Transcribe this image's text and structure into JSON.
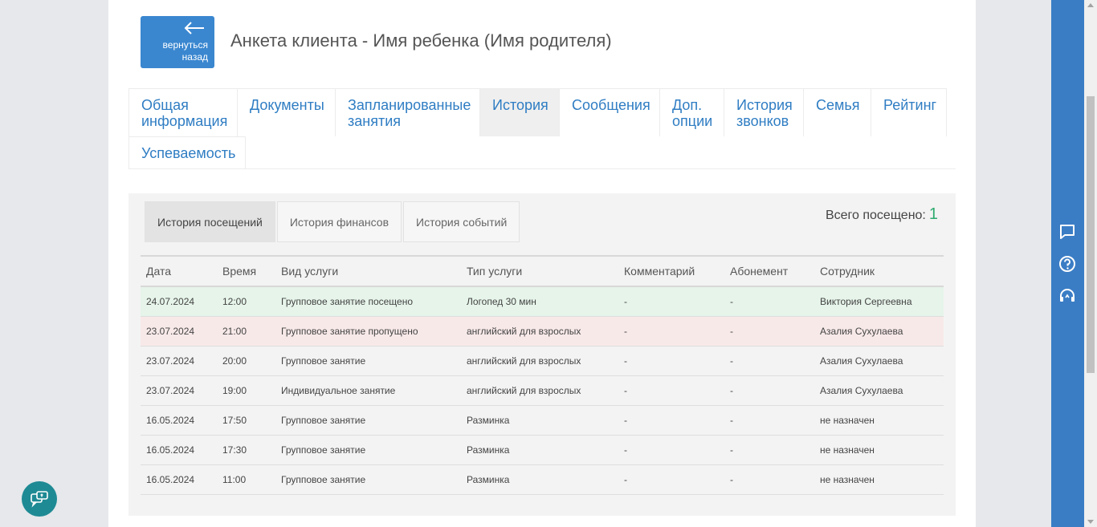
{
  "header": {
    "back_line1": "вернуться",
    "back_line2": "назад",
    "title": "Анкета клиента - Имя ребенка (Имя родителя)"
  },
  "tabs": [
    {
      "l1": "Общая",
      "l2": "информация"
    },
    {
      "l1": "Документы",
      "l2": ""
    },
    {
      "l1": "Запланированные",
      "l2": "занятия"
    },
    {
      "l1": "История",
      "l2": ""
    },
    {
      "l1": "Сообщения",
      "l2": ""
    },
    {
      "l1": "Доп.",
      "l2": "опции"
    },
    {
      "l1": "История",
      "l2": "звонков"
    },
    {
      "l1": "Семья",
      "l2": ""
    },
    {
      "l1": "Рейтинг",
      "l2": ""
    },
    {
      "l1": "Успеваемость",
      "l2": ""
    }
  ],
  "subtabs": [
    "История посещений",
    "История финансов",
    "История событий"
  ],
  "total": {
    "label": "Всего посещено:",
    "value": "1"
  },
  "table": {
    "headers": [
      "Дата",
      "Время",
      "Вид услуги",
      "Тип услуги",
      "Комментарий",
      "Абонемент",
      "Сотрудник"
    ],
    "rows": [
      [
        "24.07.2024",
        "12:00",
        "Групповое занятие посещено",
        "Логопед 30 мин",
        "-",
        "-",
        "Виктория Сергеевна"
      ],
      [
        "23.07.2024",
        "21:00",
        "Групповое занятие пропущено",
        "английский для взрослых",
        "-",
        "-",
        "Азалия Сухулаева"
      ],
      [
        "23.07.2024",
        "20:00",
        "Групповое занятие",
        "английский для взрослых",
        "-",
        "-",
        "Азалия Сухулаева"
      ],
      [
        "23.07.2024",
        "19:00",
        "Индивидуальное занятие",
        "английский для взрослых",
        "-",
        "-",
        "Азалия Сухулаева"
      ],
      [
        "16.05.2024",
        "17:50",
        "Групповое занятие",
        "Разминка",
        "-",
        "-",
        "не назначен"
      ],
      [
        "16.05.2024",
        "17:30",
        "Групповое занятие",
        "Разминка",
        "-",
        "-",
        "не назначен"
      ],
      [
        "16.05.2024",
        "11:00",
        "Групповое занятие",
        "Разминка",
        "-",
        "-",
        "не назначен"
      ]
    ]
  },
  "icons": {
    "back": "arrow-left-icon",
    "sidebar": [
      "chat-bubble-icon",
      "help-circle-icon",
      "support-headset-icon"
    ],
    "fab": "chat-support-icon"
  },
  "colors": {
    "accent": "#3a87d0",
    "sidebar": "#3a7dc5",
    "tab_link": "#2f7dc3",
    "attended_row": "#e6f4ea",
    "missed_row": "#f8e9e9",
    "total_number": "#2eaa6e",
    "fab": "#1e8a94"
  }
}
